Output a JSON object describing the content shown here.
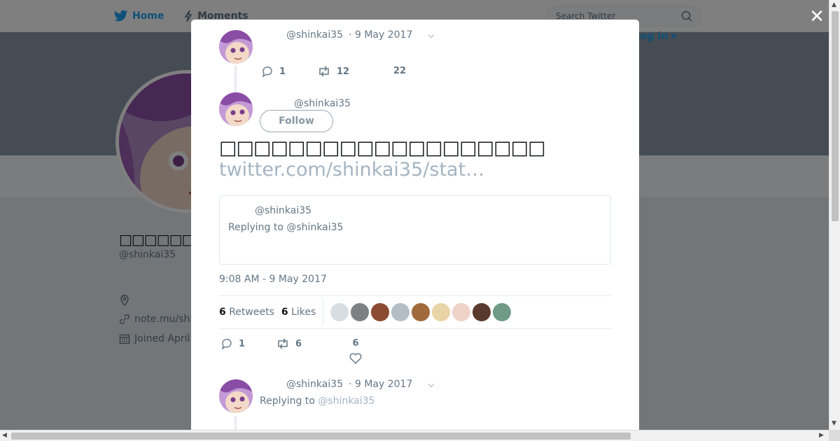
{
  "nav": {
    "home_label": "Home",
    "moments_label": "Moments",
    "search_placeholder": "Search Twitter",
    "login_label": "Log in"
  },
  "profile": {
    "name": "□□□□□□□□□□",
    "handle": "@shinkai35",
    "website": "note.mu/shi",
    "joined": "Joined April"
  },
  "tweets": [
    {
      "handle": "@shinkai35",
      "date": "· 9 May 2017",
      "replies": "1",
      "retweets": "12",
      "likes": "22"
    },
    {
      "handle": "@shinkai35",
      "follow_label": "Follow",
      "text": "□□□□□□□□□□□□□□□□□□□",
      "link": "twitter.com/shinkai35/stat…",
      "quote": {
        "handle": "@shinkai35",
        "replying_prefix": "Replying to",
        "replying_to": "@shinkai35"
      },
      "timestamp": "9:08 AM - 9 May 2017",
      "retweet_count": "6",
      "retweet_label": "Retweets",
      "like_count": "6",
      "like_label": "Likes",
      "replies": "1",
      "retweets": "6",
      "likes": "6"
    },
    {
      "handle": "@shinkai35",
      "date": "· 9 May 2017",
      "replying_prefix": "Replying to",
      "replying_to": "@shinkai35"
    }
  ],
  "colors": {
    "brand": "#1da1f2",
    "muted": "#657786",
    "link_faded": "#a5b4c2"
  },
  "icons": [
    "twitter-bird-icon",
    "lightning-icon",
    "search-icon",
    "close-icon",
    "reply-icon",
    "retweet-icon",
    "heart-icon",
    "chevron-down-icon",
    "location-icon",
    "link-icon",
    "calendar-icon"
  ]
}
